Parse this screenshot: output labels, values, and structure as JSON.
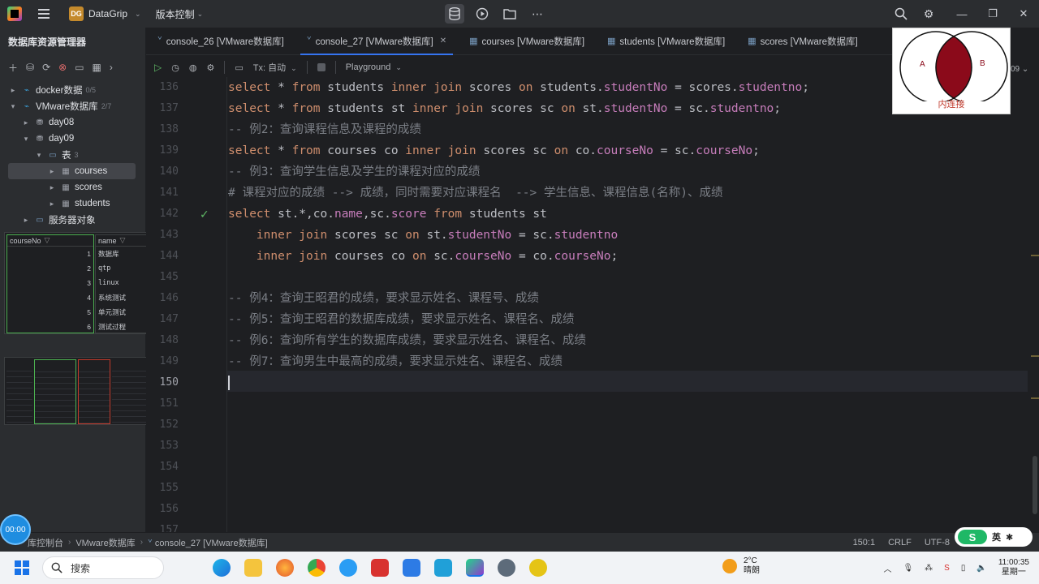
{
  "titlebar": {
    "project_badge": "DG",
    "project_name": "DataGrip",
    "vcs_label": "版本控制"
  },
  "sidebar": {
    "title": "数据库资源管理器",
    "tree": [
      {
        "label": "docker数据",
        "count": "0/5",
        "level": 0,
        "arrow": "▸",
        "icon": "database-icon"
      },
      {
        "label": "VMware数据库",
        "count": "2/7",
        "level": 0,
        "arrow": "▾",
        "icon": "database-icon"
      },
      {
        "label": "day08",
        "count": "",
        "level": 1,
        "arrow": "▸",
        "icon": "schema-icon"
      },
      {
        "label": "day09",
        "count": "",
        "level": 1,
        "arrow": "▾",
        "icon": "schema-icon"
      },
      {
        "label": "表",
        "count": "3",
        "level": 2,
        "arrow": "▾",
        "icon": "folder-icon"
      },
      {
        "label": "courses",
        "count": "",
        "level": 3,
        "arrow": "▸",
        "icon": "table-icon"
      },
      {
        "label": "scores",
        "count": "",
        "level": 3,
        "arrow": "▸",
        "icon": "table-icon"
      },
      {
        "label": "students",
        "count": "",
        "level": 3,
        "arrow": "▸",
        "icon": "table-icon"
      },
      {
        "label": "服务器对象",
        "count": "",
        "level": 1,
        "arrow": "▸",
        "icon": "folder-icon"
      }
    ],
    "preview_table": {
      "col1_header": "courseNo",
      "col2_header": "name",
      "rows": [
        {
          "no": "1",
          "name": "数据库"
        },
        {
          "no": "2",
          "name": "qtp"
        },
        {
          "no": "3",
          "name": "linux"
        },
        {
          "no": "4",
          "name": "系统测试"
        },
        {
          "no": "5",
          "name": "单元测试"
        },
        {
          "no": "6",
          "name": "测试过程"
        }
      ]
    }
  },
  "tabs": [
    {
      "label": "console_26 [VMware数据库]",
      "active": false,
      "closable": false
    },
    {
      "label": "console_27 [VMware数据库]",
      "active": true,
      "closable": true
    },
    {
      "label": "courses [VMware数据库]",
      "active": false,
      "closable": false
    },
    {
      "label": "students [VMware数据库]",
      "active": false,
      "closable": false
    },
    {
      "label": "scores [VMware数据库]",
      "active": false,
      "closable": false
    }
  ],
  "editor_toolbar": {
    "tx_label": "Tx: 自动",
    "playground_label": "Playground"
  },
  "editor": {
    "current_line": "150",
    "lines": [
      {
        "num": "136",
        "html": "select"
      },
      {
        "num": "137"
      },
      {
        "num": "138"
      },
      {
        "num": "139"
      },
      {
        "num": "140"
      },
      {
        "num": "141"
      },
      {
        "num": "142"
      },
      {
        "num": "143"
      },
      {
        "num": "144"
      },
      {
        "num": "145"
      },
      {
        "num": "146"
      },
      {
        "num": "147"
      },
      {
        "num": "148"
      },
      {
        "num": "149"
      },
      {
        "num": "150"
      },
      {
        "num": "151"
      },
      {
        "num": "152"
      },
      {
        "num": "153"
      },
      {
        "num": "154"
      },
      {
        "num": "155"
      },
      {
        "num": "156"
      },
      {
        "num": "157"
      }
    ],
    "code": {
      "l136": [
        "select",
        " * ",
        "from",
        " students ",
        "inner join",
        " scores ",
        "on",
        " students.",
        "studentNo",
        " = scores.",
        "studentno",
        ";"
      ],
      "l137": [
        "select",
        " * ",
        "from",
        " students st ",
        "inner join",
        " scores sc ",
        "on",
        " st.",
        "studentNo",
        " = sc.",
        "studentno",
        ";"
      ],
      "l138": "-- 例2：查询课程信息及课程的成绩",
      "l139": [
        "select",
        " * ",
        "from",
        " courses co ",
        "inner join",
        " scores sc ",
        "on",
        " co.",
        "courseNo",
        " = sc.",
        "courseNo",
        ";"
      ],
      "l140": "-- 例3：查询学生信息及学生的课程对应的成绩",
      "l141": "# 课程对应的成绩 --> 成绩，同时需要对应课程名  --> 学生信息、课程信息(名称)、成绩",
      "l142": [
        "select",
        " st.*,co.",
        "name",
        ",sc.",
        "score",
        " ",
        "from",
        " students st"
      ],
      "l143": [
        "    ",
        "inner join",
        " scores sc ",
        "on",
        " st.",
        "studentNo",
        " = sc.",
        "studentno"
      ],
      "l144": [
        "    ",
        "inner join",
        " courses co ",
        "on",
        " sc.",
        "courseNo",
        " = co.",
        "courseNo",
        ";"
      ],
      "l146": "-- 例4：查询王昭君的成绩，要求显示姓名、课程号、成绩",
      "l147": "-- 例5：查询王昭君的数据库成绩，要求显示姓名、课程名、成绩",
      "l148": "-- 例6：查询所有学生的数据库成绩，要求显示姓名、课程名、成绩",
      "l149": "-- 例7：查询男生中最高的成绩，要求显示姓名、课程名、成绩"
    }
  },
  "venn": {
    "left_label": "A",
    "right_label": "B",
    "caption": "内连接"
  },
  "statusbar": {
    "crumb1": "库控制台",
    "crumb2": "VMware数据库",
    "crumb3": "console_27 [VMware数据库]",
    "position": "150:1",
    "line_sep": "CRLF",
    "encoding": "UTF-8",
    "timer": "00:00",
    "ime_label": "英"
  },
  "taskbar": {
    "search_placeholder": "搜索",
    "temperature": "2°C",
    "weather": "晴朗",
    "time": "11:00:35",
    "day": "星期一"
  },
  "colors": {
    "keyword": "#cf8e6d",
    "field": "#c77dbb",
    "comment": "#7a7e85",
    "accent": "#3574f0",
    "venn_fill": "#8b0a1a"
  }
}
